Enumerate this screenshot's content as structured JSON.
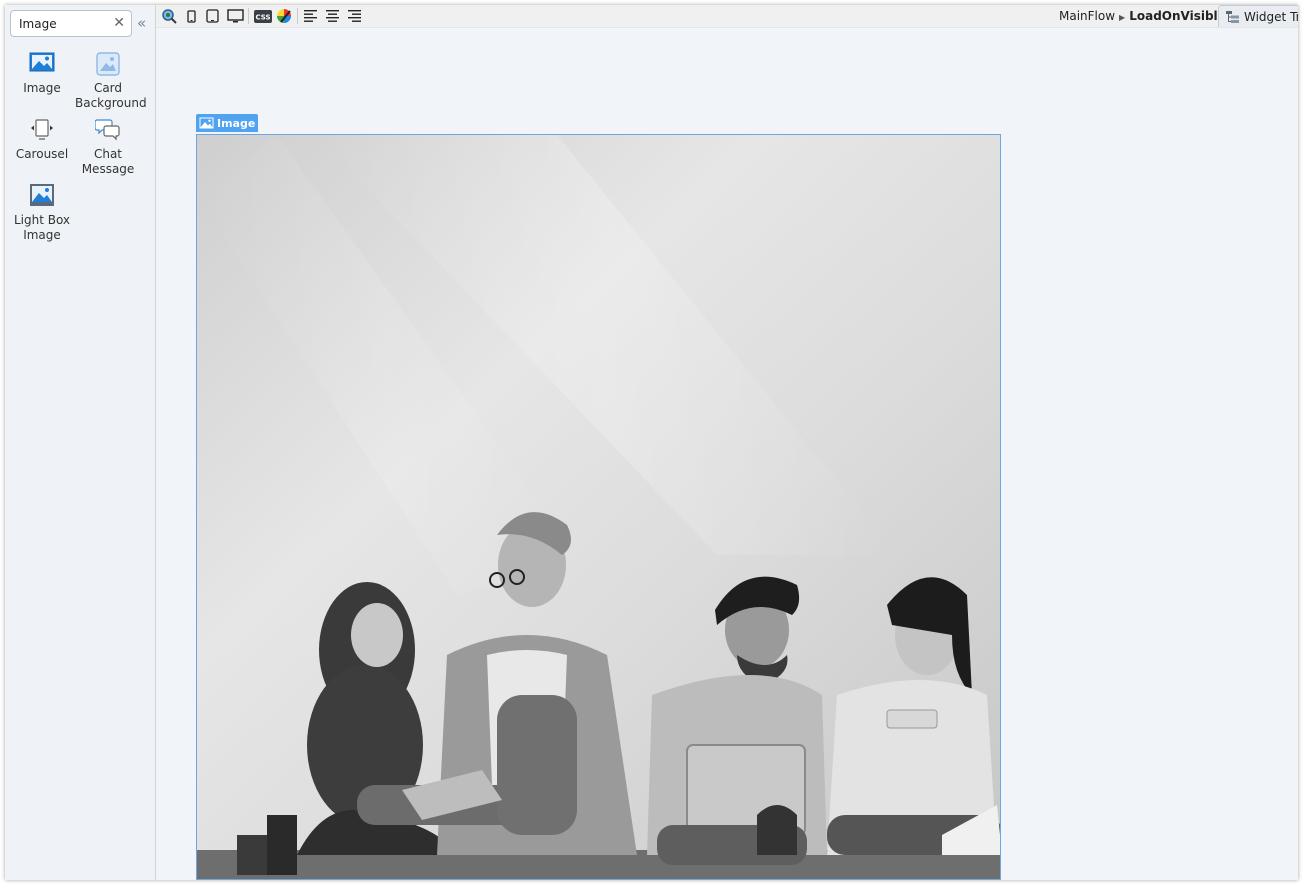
{
  "search": {
    "value": "Image",
    "clear_icon": "close-icon"
  },
  "panel": {
    "widgets": [
      {
        "label": "Image",
        "icon": "image-icon"
      },
      {
        "label": "Card Background",
        "icon": "card-background-icon"
      },
      {
        "label": "Carousel",
        "icon": "carousel-icon"
      },
      {
        "label": "Chat Message",
        "icon": "chat-message-icon"
      },
      {
        "label": "Light Box Image",
        "icon": "lightbox-image-icon"
      }
    ]
  },
  "toolbar": {
    "buttons": [
      "preview-icon",
      "phone-icon",
      "tablet-icon",
      "desktop-icon",
      "css-icon",
      "theme-icon",
      "align-left-icon",
      "align-center-icon",
      "align-right-icon"
    ]
  },
  "breadcrumb": {
    "parent": "MainFlow",
    "current": "LoadOnVisible"
  },
  "widget_tree_tab": {
    "label": "Widget Tree"
  },
  "canvas": {
    "selected_widget_label": "Image"
  },
  "colors": {
    "accent": "#4fa3f0",
    "panel_bg": "#eff3f7",
    "canvas_bg": "#f1f4f8"
  }
}
